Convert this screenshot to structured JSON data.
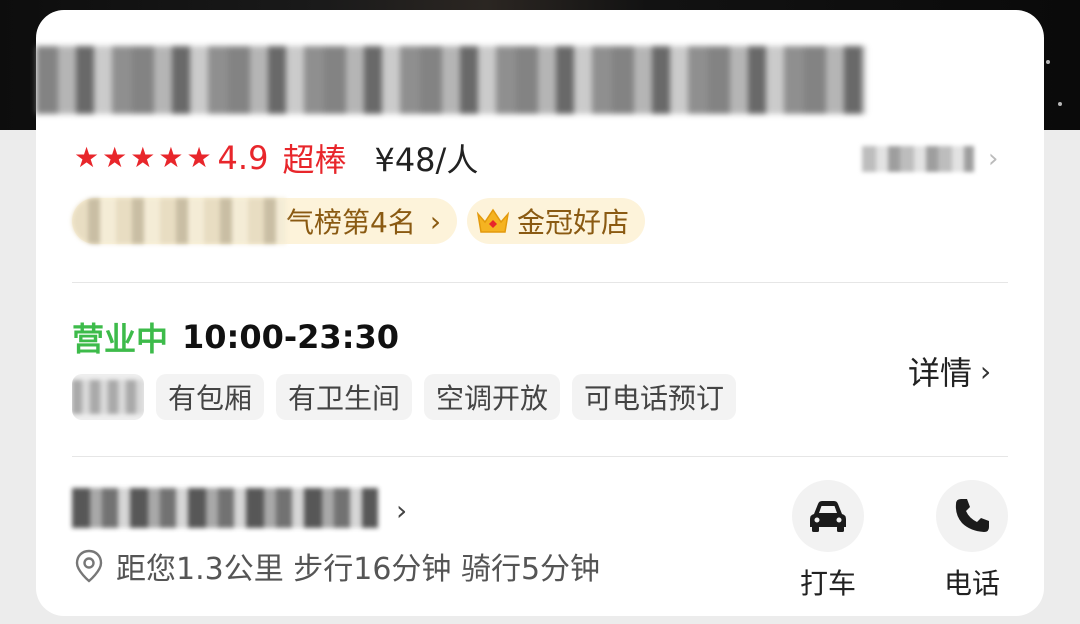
{
  "shop": {
    "rating_score": "4.9",
    "rating_tag": "超棒",
    "price_per_person": "¥48/人",
    "stars": 5
  },
  "badges": {
    "rank_text": "气榜第4名",
    "crown_text": "金冠好店"
  },
  "hours": {
    "status": "营业中",
    "time_range": "10:00-23:30",
    "details_label": "详情"
  },
  "facilities": [
    "有包厢",
    "有卫生间",
    "空调开放",
    "可电话预订"
  ],
  "location": {
    "distance_text": "距您1.3公里 步行16分钟 骑行5分钟"
  },
  "actions": {
    "taxi_label": "打车",
    "phone_label": "电话"
  },
  "colors": {
    "rating_red": "#e8262b",
    "open_green": "#3dbb4a",
    "badge_bg": "#fdf3da",
    "badge_text": "#8a5a12"
  }
}
